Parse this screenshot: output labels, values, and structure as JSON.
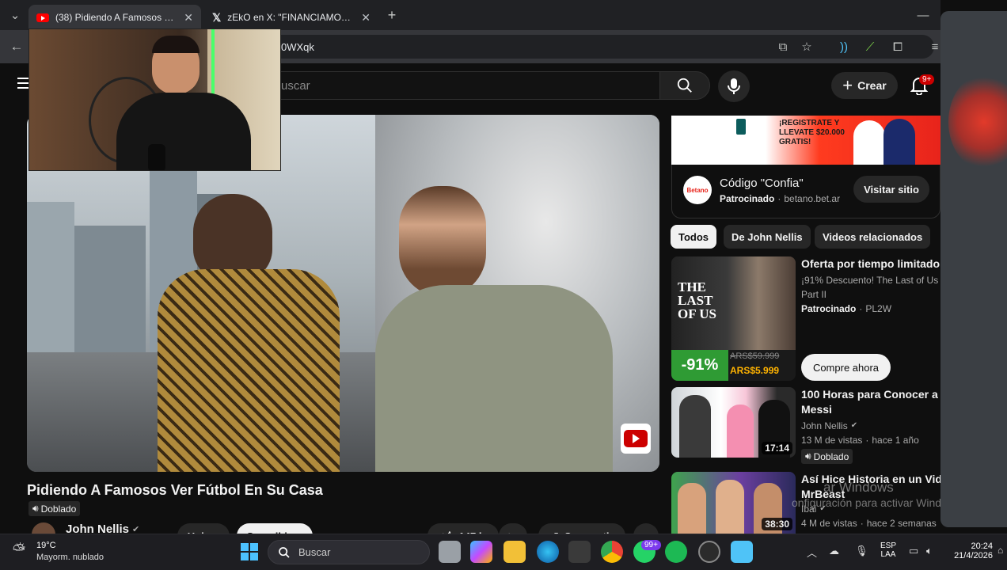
{
  "browser": {
    "tabs": [
      {
        "title": "(38) Pidiendo A Famosos Ver Fút",
        "active": true
      },
      {
        "title": "zEkO en X: \"FINANCIAMOS LA",
        "active": false
      }
    ],
    "url_fragment": "0WXqk"
  },
  "masthead": {
    "search_placeholder": "uscar",
    "create_label": "Crear",
    "notification_count": "9+"
  },
  "video": {
    "title": "Pidiendo A Famosos Ver Fútbol En Su Casa",
    "dubbed_label": "Doblado",
    "channel_name": "John Nellis",
    "join_label": "Unirse",
    "subscribe_label": "Suscribirse",
    "likes": "147 k",
    "share_label": "Compartir"
  },
  "ad": {
    "banner_text": "¡REGISTRATE Y LLEVATE $20.000 GRATIS!",
    "brand_logo": "Betano",
    "headline": "Código \"Confia\"",
    "sponsored_label": "Patrocinado",
    "domain": "betano.bet.ar",
    "cta_label": "Visitar sitio"
  },
  "chips": [
    {
      "label": "Todos",
      "selected": true
    },
    {
      "label": "De John Nellis",
      "selected": false
    },
    {
      "label": "Videos relacionados",
      "selected": false
    }
  ],
  "recommendations": [
    {
      "title": "Oferta por tiempo limitado",
      "subtitle": "¡91% Descuento! The Last of Us Part II",
      "sponsored": "Patrocinado",
      "channel": "PL2W",
      "discount": "-91%",
      "old_price": "ARS$59.999",
      "new_price": "ARS$5.999",
      "cta": "Compre ahora",
      "thumb_title": "THE LAST OF US"
    },
    {
      "title": "100 Horas para Conocer a Messi",
      "channel": "John Nellis",
      "views": "13 M de vistas",
      "age": "hace 1 año",
      "dubbed": "Doblado",
      "duration": "17:14"
    },
    {
      "title": "Así Hice Historia en un Video c",
      "title2": "MrBeast",
      "channel": "Ibai",
      "views": "4 M de vistas",
      "age": "hace 2 semanas",
      "duration": "38:30"
    }
  ],
  "watermark": {
    "line1": "ar Windows",
    "line2": "onfiguración para activar Windows."
  },
  "taskbar": {
    "weather_temp": "19°C",
    "weather_desc": "Mayorm. nublado",
    "search_placeholder": "Buscar",
    "whatsapp_badge": "99+",
    "lang": "ESP",
    "lang2": "LAA",
    "time": "20:24",
    "date": "21/4/2026"
  },
  "colors": {
    "yt_red": "#ff0000",
    "background": "#0f0f0f",
    "chip_bg": "#272727",
    "betano_orange": "#ff3b1f"
  }
}
